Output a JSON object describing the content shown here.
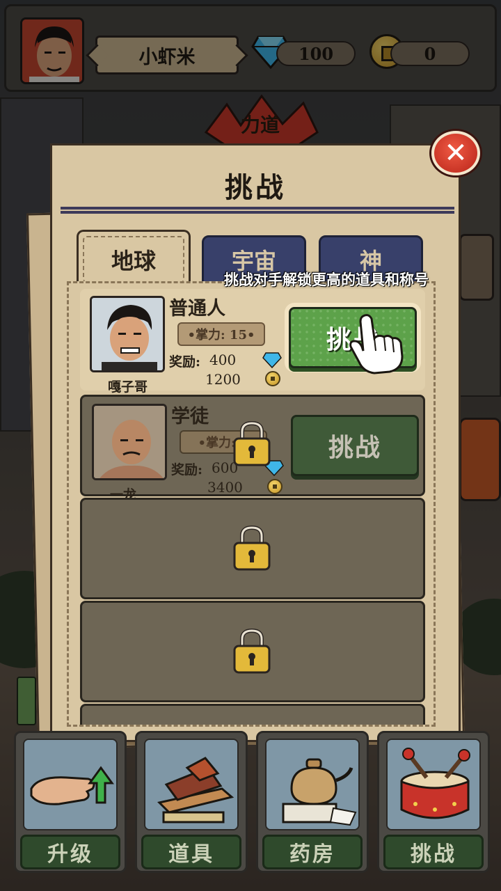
{
  "player": {
    "name": "小虾米",
    "gems": "100",
    "coins": "0"
  },
  "banner": {
    "label": "力道"
  },
  "panel": {
    "title": "挑战",
    "tabs": [
      {
        "label": "地球",
        "active": true
      },
      {
        "label": "宇宙",
        "active": false
      },
      {
        "label": "神",
        "active": false
      }
    ],
    "tip": "挑战对手解锁更高的道具和称号"
  },
  "opponents": [
    {
      "title": "普通人",
      "power": "•掌力: 15•",
      "reward_label": "奖励:",
      "reward_gems": "400",
      "reward_coins": "1200",
      "character": "嘎子哥",
      "button": "挑战",
      "locked": false
    },
    {
      "title": "学徒",
      "power": "•掌力: 1",
      "reward_label": "奖励:",
      "reward_gems": "600",
      "reward_coins": "3400",
      "character": "一龙",
      "button": "挑战",
      "locked": true
    }
  ],
  "nav": [
    {
      "label": "升级",
      "icon": "palm-upgrade-icon"
    },
    {
      "label": "道具",
      "icon": "bricks-icon"
    },
    {
      "label": "药房",
      "icon": "teapot-icon"
    },
    {
      "label": "挑战",
      "icon": "drum-icon"
    }
  ],
  "colors": {
    "panel": "#d9c7a3",
    "tab_inactive": "#38406a",
    "button_ready": "#5da24a",
    "close": "#d33a28"
  }
}
